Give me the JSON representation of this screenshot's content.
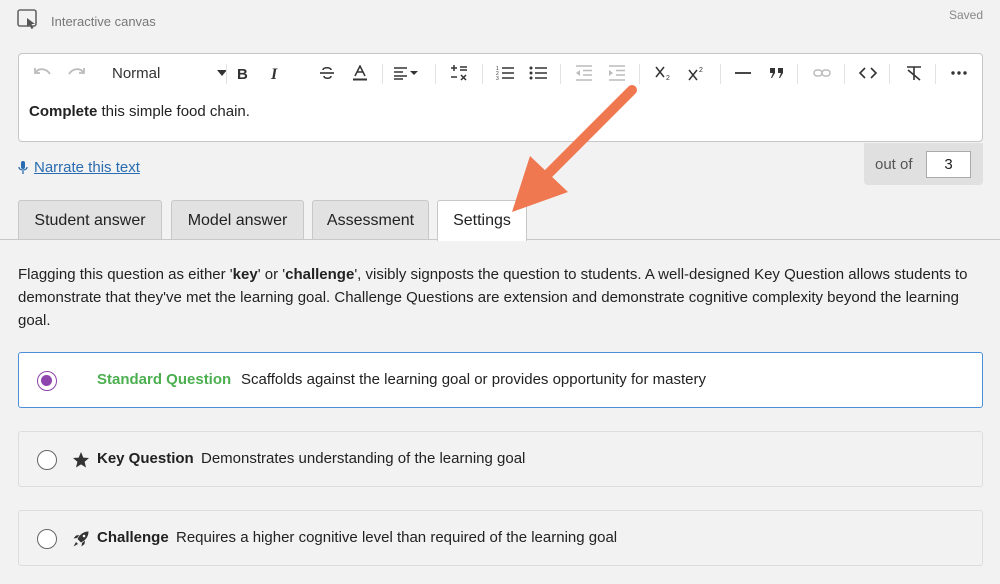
{
  "header": {
    "canvas_label": "Interactive canvas",
    "saved_label": "Saved",
    "canvas_icon": "interactive-canvas-icon"
  },
  "editor": {
    "format_value": "Normal",
    "content_bold": "Complete",
    "content_rest": " this simple food chain."
  },
  "narrate": {
    "label": "Narrate this text"
  },
  "score": {
    "out_of_label": "out of",
    "value": "3"
  },
  "tabs": [
    {
      "label": "Student answer"
    },
    {
      "label": "Model answer"
    },
    {
      "label": "Assessment"
    },
    {
      "label": "Settings",
      "active": true
    }
  ],
  "settings": {
    "desc_1": "Flagging this question as either '",
    "desc_key": "key",
    "desc_2": "' or '",
    "desc_challenge": "challenge",
    "desc_3": "', visibly signposts the question to students. A well-designed Key Question allows students to demonstrate that they've met the learning goal. Challenge Questions are extension and demonstrate cognitive complexity beyond the learning goal.",
    "options": [
      {
        "title": "Standard Question",
        "description": "Scaffolds against the learning goal or provides opportunity for mastery",
        "selected": true,
        "icon": "none"
      },
      {
        "title": "Key Question",
        "description": "Demonstrates understanding of the learning goal",
        "selected": false,
        "icon": "star-icon"
      },
      {
        "title": "Challenge",
        "description": "Requires a higher cognitive level than required of the learning goal",
        "selected": false,
        "icon": "rocket-icon"
      }
    ]
  },
  "colors": {
    "accent_link": "#2a6cb0",
    "selected_radio": "#8e44ad",
    "standard_title": "#4caf50",
    "selected_border": "#4a90d9",
    "annotation_arrow": "#f07850"
  }
}
